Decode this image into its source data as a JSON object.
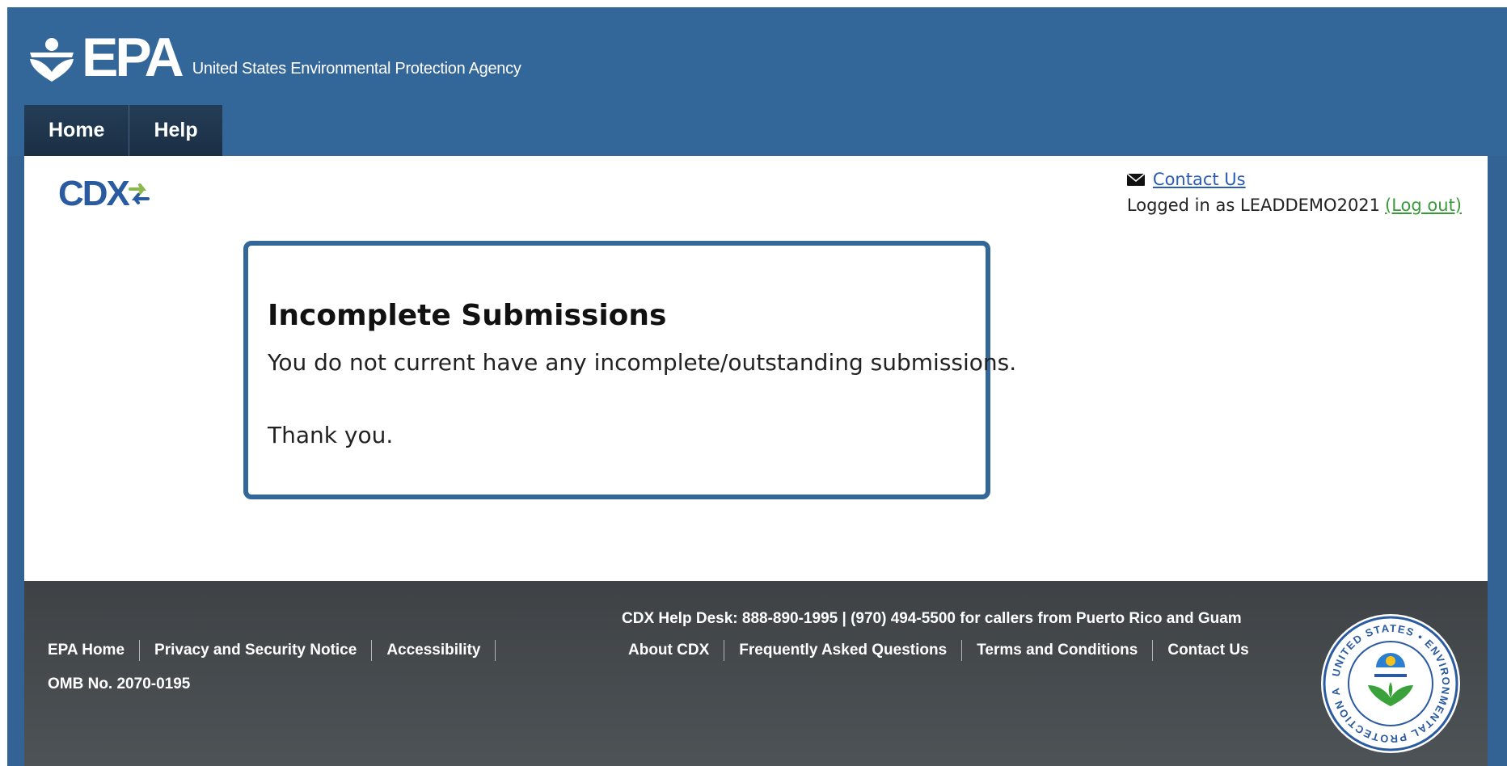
{
  "header": {
    "logo_text": "EPA",
    "agency_name": "United States Environmental Protection Agency",
    "nav": [
      {
        "label": "Home"
      },
      {
        "label": "Help"
      }
    ]
  },
  "main": {
    "cdx_logo_text": "CDX",
    "contact_label": "Contact Us",
    "logged_in_text": "Logged in as LEADDEMO2021",
    "logout_label": "(Log out)",
    "card": {
      "title": "Incomplete Submissions",
      "message": "You do not current have any incomplete/outstanding submissions.",
      "thanks": "Thank you."
    }
  },
  "footer": {
    "left_links": [
      "EPA Home",
      "Privacy and Security Notice",
      "Accessibility"
    ],
    "omb": "OMB No. 2070-0195",
    "helpdesk": "CDX Help Desk: 888-890-1995 | (970) 494-5500 for callers from Puerto Rico and Guam",
    "right_links": [
      "About CDX",
      "Frequently Asked Questions",
      "Terms and Conditions",
      "Contact Us"
    ],
    "seal_text": "UNITED STATES ENVIRONMENTAL PROTECTION AGENCY"
  },
  "colors": {
    "header_blue": "#336699",
    "nav_dark": "#1c3a57",
    "link_blue": "#2b5db8",
    "logout_green": "#3a9a3a",
    "footer_gray": "#454a4d"
  },
  "icons": [
    "epa-emblem-icon",
    "cdx-arrows-icon",
    "envelope-icon",
    "epa-seal-icon"
  ]
}
